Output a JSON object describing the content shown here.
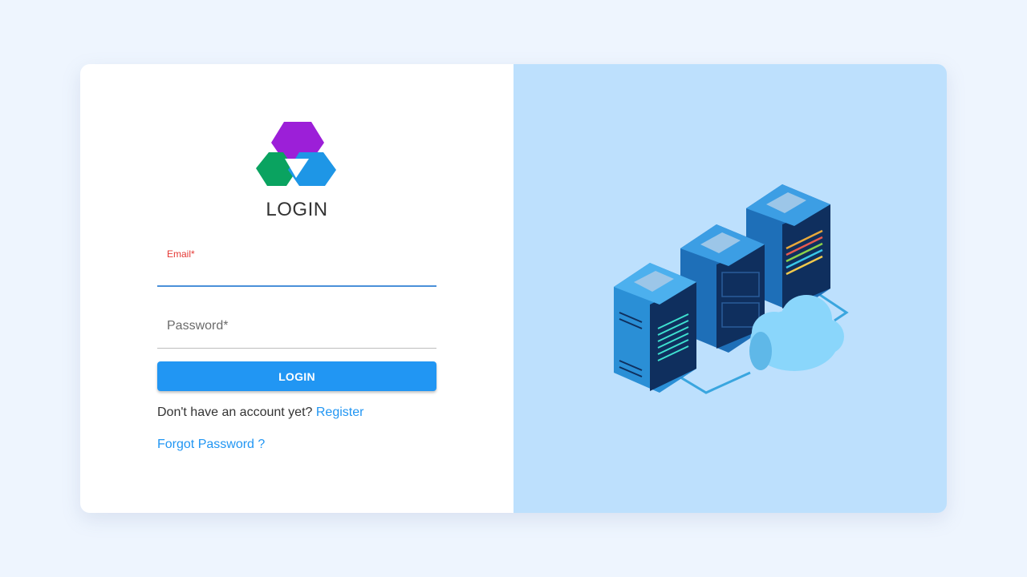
{
  "login": {
    "title": "LOGIN",
    "email_label": "Email*",
    "email_value": "",
    "password_label": "Password*",
    "password_value": "",
    "submit_label": "LOGIN",
    "register_prompt": "Don't have an account yet?",
    "register_link": "Register",
    "forgot_link": "Forgot Password ?"
  },
  "icons": {
    "logo": "brand-logo",
    "illustration": "server-cloud-illustration"
  },
  "colors": {
    "page_bg": "#eef5fe",
    "panel_bg": "#bde0fd",
    "primary": "#2196f3",
    "error_label": "#e53935",
    "logo_purple": "#9c1fd8",
    "logo_green": "#0aa360",
    "logo_blue": "#1e96e6"
  }
}
